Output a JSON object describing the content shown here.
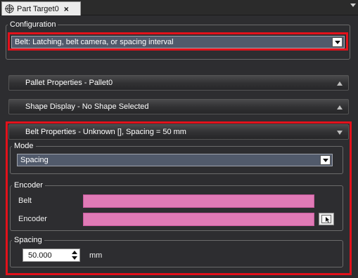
{
  "tab": {
    "title": "Part Target0",
    "close": "×",
    "icon": "target-icon"
  },
  "configuration": {
    "legend": "Configuration",
    "selected": "Belt: Latching, belt camera, or spacing interval"
  },
  "sections": {
    "pallet": "Pallet Properties - Pallet0",
    "shape": "Shape Display - No Shape Selected",
    "belt": "Belt Properties -  Unknown [], Spacing = 50 mm"
  },
  "mode": {
    "legend": "Mode",
    "selected": "Spacing"
  },
  "encoder_group": {
    "legend": "Encoder",
    "belt_label": "Belt",
    "encoder_label": "Encoder",
    "belt_value": "",
    "encoder_value": ""
  },
  "spacing": {
    "legend": "Spacing",
    "value": "50.000",
    "unit": "mm"
  },
  "colors": {
    "highlight": "#e3111b",
    "unassigned_field": "#e07ab6",
    "combo_bg": "#515a6b"
  }
}
